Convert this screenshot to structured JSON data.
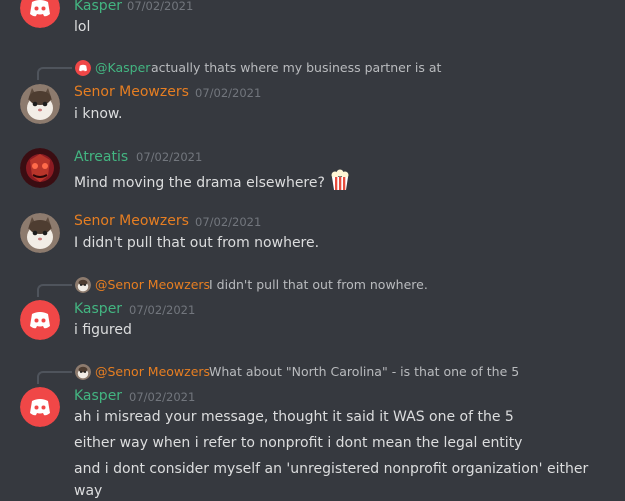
{
  "colors": {
    "background": "#36393f",
    "kasper": "#43b581",
    "senor": "#e67e22",
    "atreatis": "#43b581",
    "discord_red": "#f04747"
  },
  "messages": [
    {
      "author": "Kasper",
      "timestamp": "07/02/2021",
      "lines": [
        "lol"
      ],
      "avatar_icon": "discord-logo"
    },
    {
      "reply": {
        "mention": "@Kasper",
        "text": "actually thats where my business partner is at",
        "icon": "discord-logo"
      },
      "author": "Senor Meowzers",
      "timestamp": "07/02/2021",
      "lines": [
        "i know."
      ],
      "avatar_icon": "cat-photo"
    },
    {
      "author": "Atreatis",
      "timestamp": "07/02/2021",
      "lines": [
        "Mind moving the drama elsewhere? "
      ],
      "emoji": "popcorn",
      "avatar_icon": "red-graphic"
    },
    {
      "author": "Senor Meowzers",
      "timestamp": "07/02/2021",
      "lines": [
        "I didn't pull that out from nowhere."
      ],
      "avatar_icon": "cat-photo"
    },
    {
      "reply": {
        "mention": "@Senor Meowzers",
        "text": "I didn't pull that out from nowhere.",
        "icon": "cat-photo"
      },
      "author": "Kasper",
      "timestamp": "07/02/2021",
      "lines": [
        "i figured"
      ],
      "avatar_icon": "discord-logo"
    },
    {
      "reply": {
        "mention": "@Senor Meowzers",
        "text": "What about \"North Carolina\" - is that one of the 5",
        "icon": "cat-photo"
      },
      "author": "Kasper",
      "timestamp": "07/02/2021",
      "lines": [
        "ah i misread your message, thought it said it WAS one of the 5",
        "either way when i refer to nonprofit i dont mean the legal entity",
        "and i dont consider myself an 'unregistered nonprofit organization' either",
        "way"
      ],
      "avatar_icon": "discord-logo"
    }
  ]
}
